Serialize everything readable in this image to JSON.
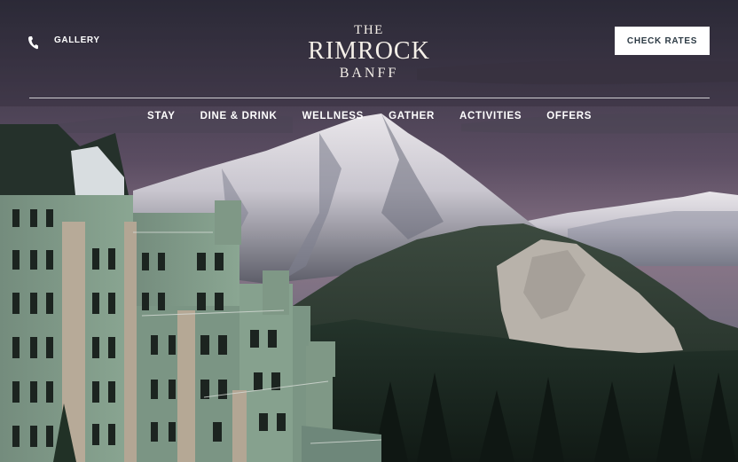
{
  "header": {
    "gallery_label": "GALLERY",
    "phone_icon": "phone-icon",
    "logo": {
      "line1": "THE",
      "line2": "RIMROCK",
      "line3": "BANFF"
    },
    "cta_label": "CHECK RATES"
  },
  "nav": {
    "items": [
      {
        "label": "STAY"
      },
      {
        "label": "DINE & DRINK"
      },
      {
        "label": "WELLNESS"
      },
      {
        "label": "GATHER"
      },
      {
        "label": "ACTIVITIES"
      },
      {
        "label": "OFFERS"
      }
    ]
  },
  "hero": {
    "description_icon": "hero-photo",
    "colors": {
      "sky_top": "#3d3a4d",
      "sky_mid": "#6a5a72",
      "horizon": "#9a7a8a",
      "forest": "#1d2a24",
      "building": "#7f9a86"
    }
  }
}
